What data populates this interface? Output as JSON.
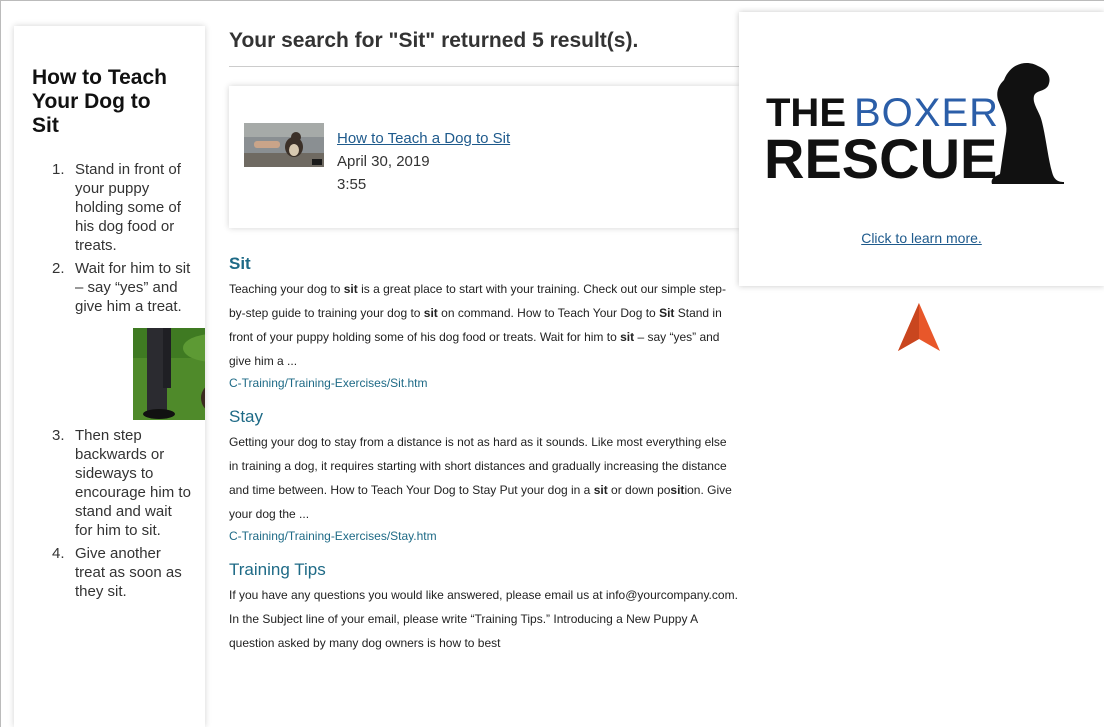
{
  "sidebar": {
    "title": "How to Teach Your Dog to Sit",
    "steps": [
      {
        "num": "1.",
        "text": "Stand in front of your puppy holding some of his dog food or treats."
      },
      {
        "num": "2.",
        "text": "Wait for him to sit – say “yes” and give him a treat."
      },
      {
        "num": "3.",
        "text": "Then step backwards or sideways to encourage him to stand and wait for him to sit."
      },
      {
        "num": "4.",
        "text": "Give another treat as soon as they sit."
      }
    ]
  },
  "main": {
    "heading": "Your search for \"Sit\" returned 5 result(s).",
    "video": {
      "title": "How to Teach a Dog to Sit",
      "date": "April 30, 2019",
      "duration": "3:55"
    },
    "results": [
      {
        "title": "Sit",
        "snippet_parts": [
          {
            "t": "Teaching your dog to "
          },
          {
            "t": "sit",
            "b": true
          },
          {
            "t": " is a great place to start with your training. Check out our simple step-by-step guide to training your dog to "
          },
          {
            "t": "sit",
            "b": true
          },
          {
            "t": " on command. How to Teach Your Dog to "
          },
          {
            "t": "Sit",
            "b": true
          },
          {
            "t": " Stand in front of your puppy holding some of his dog food or treats. Wait for him to "
          },
          {
            "t": "sit",
            "b": true
          },
          {
            "t": " – say “yes” and give him a ..."
          }
        ],
        "path": "C-Training/Training-Exercises/Sit.htm"
      },
      {
        "title": "Stay",
        "snippet_parts": [
          {
            "t": "Getting your dog to stay from a distance is not as hard as it sounds. Like most everything else in training a dog, it requires starting with short distances and gradually increasing the distance and time between. How to Teach Your Dog to Stay Put your dog in a "
          },
          {
            "t": "sit",
            "b": true
          },
          {
            "t": " or down po"
          },
          {
            "t": "sit",
            "b": true
          },
          {
            "t": "ion. Give your dog the ..."
          }
        ],
        "path": "C-Training/Training-Exercises/Stay.htm"
      },
      {
        "title": "Training Tips",
        "snippet_parts": [
          {
            "t": "If you have any questions you would like answered, please email us at info@yourcompany.com. In the Subject line of your email, please write “Training Tips.” Introducing a New Puppy A question asked by many dog owners is how to best"
          }
        ],
        "path": ""
      }
    ]
  },
  "ad": {
    "logo_line1_a": "THE",
    "logo_line1_b": "BOXER",
    "logo_line2": "RESCUE",
    "link": "Click to learn more."
  },
  "colors": {
    "link": "#1e5a8c",
    "result_title": "#1e6a86",
    "cursor": "#e8572a"
  }
}
